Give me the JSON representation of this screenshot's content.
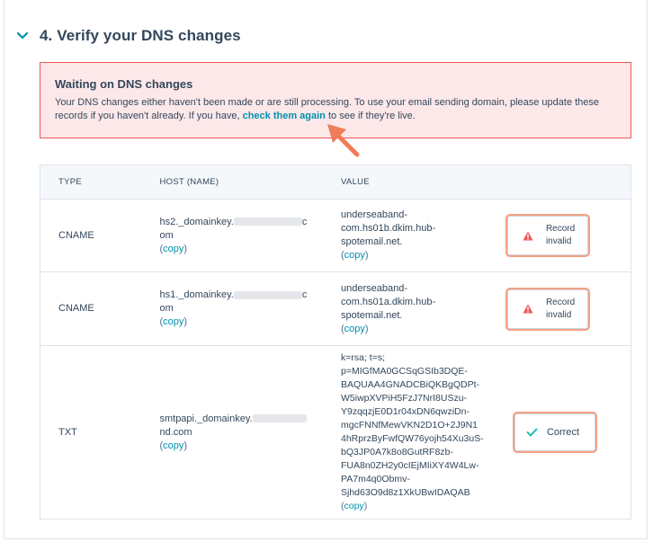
{
  "section": {
    "title": "4. Verify your DNS changes"
  },
  "alert": {
    "title": "Waiting on DNS changes",
    "body_before": "Your DNS changes either haven't been made or are still processing. To use your email sending domain, please update these records if you haven't already. If you have,",
    "link": "check them again",
    "body_after": "to see if they're live."
  },
  "table": {
    "headers": {
      "type": "TYPE",
      "host": "HOST (NAME)",
      "value": "VALUE"
    },
    "copy_label": "copy",
    "rows": [
      {
        "type": "CNAME",
        "host_line1": "hs2._domainkey.",
        "host_tail1": "c",
        "host_line2": "om",
        "value_lines": [
          "underseaband-",
          "com.hs01b.dkim.hub-",
          "spotemail.net."
        ],
        "status": "Record invalid",
        "status_l1": "Record",
        "status_l2": "invalid"
      },
      {
        "type": "CNAME",
        "host_line1": "hs1._domainkey.",
        "host_tail1": "c",
        "host_line2": "om",
        "value_lines": [
          "underseaband-",
          "com.hs01a.dkim.hub-",
          "spotemail.net."
        ],
        "status": "Record invalid",
        "status_l1": "Record",
        "status_l2": "invalid"
      },
      {
        "type": "TXT",
        "host_line1": "smtpapi._domainkey.",
        "host_tail1": "",
        "host_line2": "nd.com",
        "value_lines": [
          "k=rsa; t=s;",
          "p=MIGfMA0GCSqGSIb3DQE-",
          "BAQUAA4GNADCBiQKBgQDPt-",
          "W5iwpXVPiH5FzJ7NrI8USzu-",
          "Y9zqqzjE0D1r04xDN6qwziDn-",
          "mgcFNNfMewVKN2D1O+2J9N1",
          "4hRprzByFwfQW76yojh54Xu3uS-",
          "bQ3JP0A7k8o8GutRF8zb-",
          "FUA8n0ZH2y0cIEjMIiXY4W4Lw-",
          "PA7m4q0Obmv-",
          "Sjhd63O9d8z1XkUBwIDAQAB"
        ],
        "status": "Correct"
      }
    ]
  },
  "colors": {
    "accent": "#0091ae",
    "danger": "#f2545b",
    "success": "#00bda5",
    "highlight": "#f5a183"
  }
}
